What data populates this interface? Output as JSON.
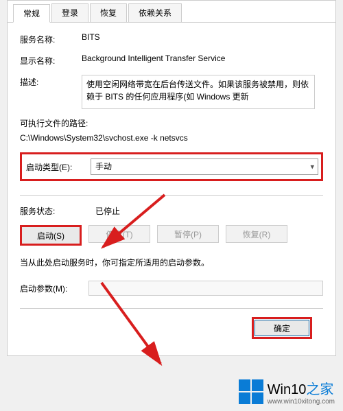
{
  "tabs": [
    "常规",
    "登录",
    "恢复",
    "依赖关系"
  ],
  "active_tab": 0,
  "fields": {
    "service_name_label": "服务名称:",
    "service_name": "BITS",
    "display_name_label": "显示名称:",
    "display_name": "Background Intelligent Transfer Service",
    "description_label": "描述:",
    "description": "使用空闲网络带宽在后台传送文件。如果该服务被禁用，则依赖于 BITS 的任何应用程序(如 Windows 更新",
    "exec_path_label": "可执行文件的路径:",
    "exec_path": "C:\\Windows\\System32\\svchost.exe -k netsvcs",
    "startup_type_label": "启动类型(E):",
    "startup_type": "手动"
  },
  "status": {
    "label": "服务状态:",
    "value": "已停止"
  },
  "buttons": {
    "start": "启动(S)",
    "stop": "停止(T)",
    "pause": "暂停(P)",
    "resume": "恢复(R)"
  },
  "hint": "当从此处启动服务时，你可指定所适用的启动参数。",
  "params": {
    "label": "启动参数(M):",
    "value": ""
  },
  "dialog_buttons": {
    "ok": "确定"
  },
  "logo": {
    "text_a": "Win10",
    "text_b": "之家",
    "url": "www.win10xitong.com"
  }
}
